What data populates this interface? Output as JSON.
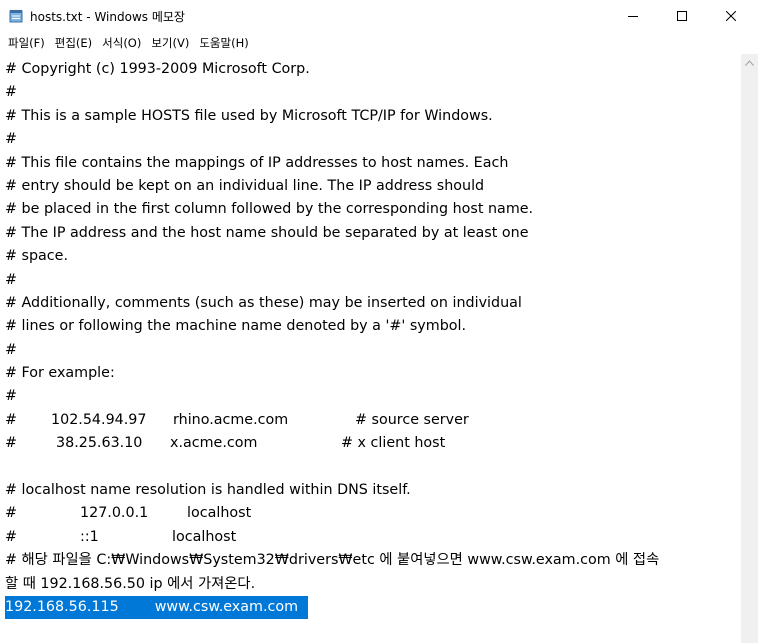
{
  "window": {
    "title": "hosts.txt - Windows 메모장",
    "icon": "notepad-icon"
  },
  "controls": {
    "minimize_icon": "minimize-icon",
    "maximize_icon": "maximize-icon",
    "close_icon": "close-icon"
  },
  "menu": {
    "items": [
      "파일(F)",
      "편집(E)",
      "서식(O)",
      "보기(V)",
      "도움말(H)"
    ]
  },
  "editor": {
    "lines": [
      "# Copyright (c) 1993-2009 Microsoft Corp.",
      "#",
      "# This is a sample HOSTS file used by Microsoft TCP/IP for Windows.",
      "#",
      "# This file contains the mappings of IP addresses to host names. Each",
      "# entry should be kept on an individual line. The IP address should",
      "# be placed in the first column followed by the corresponding host name.",
      "# The IP address and the host name should be separated by at least one",
      "# space.",
      "#",
      "# Additionally, comments (such as these) may be inserted on individual",
      "# lines or following the machine name denoted by a '#' symbol.",
      "#",
      "# For example:",
      "#"
    ],
    "example1": {
      "hash": "#",
      "ip": "102.54.94.97",
      "host": "rhino.acme.com",
      "comment": "# source server"
    },
    "example2": {
      "hash": "#",
      "ip": "38.25.63.10",
      "host": "x.acme.com",
      "comment": "# x client host"
    },
    "blank": "",
    "resolution_line": "# localhost name resolution is handled within DNS itself.",
    "localhost1": {
      "hash": "#",
      "ip": "127.0.0.1",
      "host": "localhost"
    },
    "localhost2": {
      "hash": "#",
      "ip": "::1",
      "host": "localhost"
    },
    "korean_line1": "# 해당 파일을 C:₩Windows₩System32₩drivers₩etc 에 붙여넣으면 www.csw.exam.com 에 접속",
    "korean_line2": "할 때 192.168.56.50 ip 에서 가져온다.",
    "selected_line": {
      "ip": "192.168.56.115",
      "host": "www.csw.exam.com"
    },
    "selection_color": "#0078d7"
  }
}
